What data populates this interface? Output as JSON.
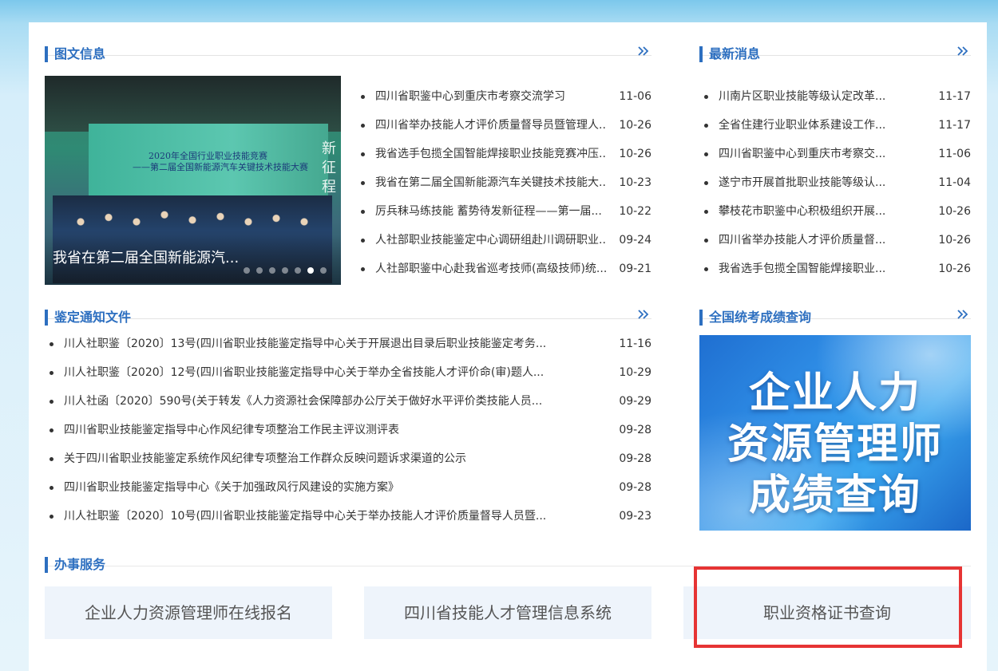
{
  "sections": {
    "picture_news": {
      "title": "图文信息"
    },
    "latest_news": {
      "title": "最新消息"
    },
    "notices": {
      "title": "鉴定通知文件"
    },
    "exam_query": {
      "title": "全国统考成绩查询"
    },
    "services": {
      "title": "办事服务"
    }
  },
  "slider": {
    "caption": "我省在第二届全国新能源汽...",
    "banner_line1": "2020年全国行业职业技能竞赛",
    "banner_line2": "——第二届全国新能源汽车关键技术技能大赛",
    "side_text": "新 征 程",
    "dots": [
      false,
      false,
      false,
      false,
      false,
      true,
      false
    ],
    "active_dot": 6
  },
  "picture_news_items": [
    {
      "title": "四川省职鉴中心到重庆市考察交流学习",
      "date": "11-06"
    },
    {
      "title": "四川省举办技能人才评价质量督导员暨管理人...",
      "date": "10-26"
    },
    {
      "title": "我省选手包揽全国智能焊接职业技能竞赛冲压...",
      "date": "10-26"
    },
    {
      "title": "我省在第二届全国新能源汽车关键技术技能大...",
      "date": "10-23"
    },
    {
      "title": "厉兵秣马练技能    蓄势待发新征程——第一届...",
      "date": "10-22"
    },
    {
      "title": "人社部职业技能鉴定中心调研组赴川调研职业...",
      "date": "09-24"
    },
    {
      "title": "人社部职鉴中心赴我省巡考技师(高级技师)统...",
      "date": "09-21"
    }
  ],
  "latest_news_items": [
    {
      "title": "川南片区职业技能等级认定改革...",
      "date": "11-17"
    },
    {
      "title": "全省住建行业职业体系建设工作...",
      "date": "11-17"
    },
    {
      "title": "四川省职鉴中心到重庆市考察交...",
      "date": "11-06"
    },
    {
      "title": "遂宁市开展首批职业技能等级认...",
      "date": "11-04"
    },
    {
      "title": "攀枝花市职鉴中心积极组织开展...",
      "date": "10-26"
    },
    {
      "title": "四川省举办技能人才评价质量督...",
      "date": "10-26"
    },
    {
      "title": "我省选手包揽全国智能焊接职业...",
      "date": "10-26"
    }
  ],
  "notice_items": [
    {
      "title": "川人社职鉴〔2020〕13号(四川省职业技能鉴定指导中心关于开展退出目录后职业技能鉴定考务...",
      "date": "11-16"
    },
    {
      "title": "川人社职鉴〔2020〕12号(四川省职业技能鉴定指导中心关于举办全省技能人才评价命(审)题人...",
      "date": "10-29"
    },
    {
      "title": "川人社函〔2020〕590号(关于转发《人力资源社会保障部办公厅关于做好水平评价类技能人员...",
      "date": "09-29"
    },
    {
      "title": "四川省职业技能鉴定指导中心作风纪律专项整治工作民主评议测评表",
      "date": "09-28"
    },
    {
      "title": "关于四川省职业技能鉴定系统作风纪律专项整治工作群众反映问题诉求渠道的公示",
      "date": "09-28"
    },
    {
      "title": "四川省职业技能鉴定指导中心《关于加强政风行风建设的实施方案》",
      "date": "09-28"
    },
    {
      "title": "川人社职鉴〔2020〕10号(四川省职业技能鉴定指导中心关于举办技能人才评价质量督导人员暨...",
      "date": "09-23"
    }
  ],
  "exam_banner": {
    "line1": "企业人力",
    "line2": "资源管理师",
    "line3": "成绩查询"
  },
  "service_buttons": [
    {
      "label": "企业人力资源管理师在线报名"
    },
    {
      "label": "四川省技能人才管理信息系统"
    },
    {
      "label": "职业资格证书查询"
    }
  ],
  "colors": {
    "accent": "#2d6fc0",
    "highlight": "#e63434",
    "service_bg": "#eef4fb"
  }
}
